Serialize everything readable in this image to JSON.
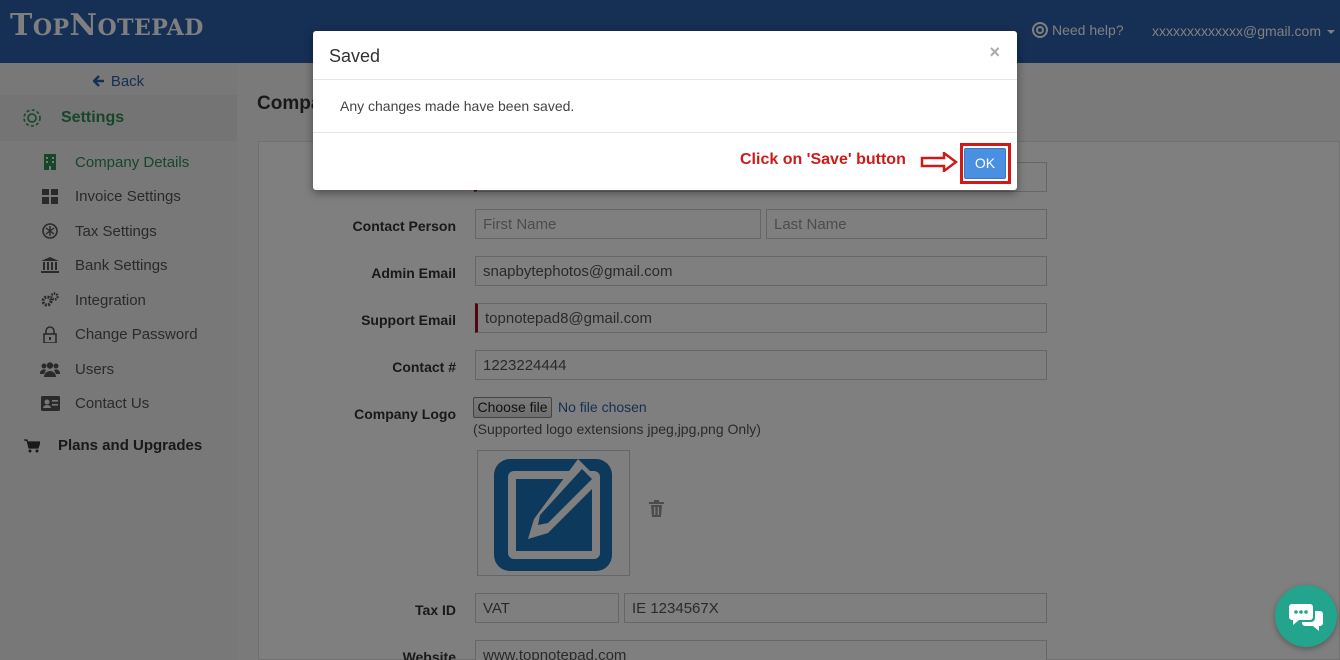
{
  "header": {
    "logo_big1": "T",
    "logo_small1": "OP",
    "logo_big2": "N",
    "logo_small2": "OTEPAD",
    "help_label": "Need help?",
    "account": "xxxxxxxxxxxxx@gmail.com"
  },
  "sidebar": {
    "back_label": "Back",
    "settings_label": "Settings",
    "items": [
      {
        "label": "Company Details",
        "icon": "building-icon",
        "active": true
      },
      {
        "label": "Invoice Settings",
        "icon": "grid-icon"
      },
      {
        "label": "Tax Settings",
        "icon": "tax-icon"
      },
      {
        "label": "Bank Settings",
        "icon": "bank-icon"
      },
      {
        "label": "Integration",
        "icon": "gears-icon"
      },
      {
        "label": "Change Password",
        "icon": "lock-icon"
      },
      {
        "label": "Users",
        "icon": "users-icon"
      },
      {
        "label": "Contact Us",
        "icon": "contact-card-icon"
      }
    ],
    "plans_label": "Plans and Upgrades"
  },
  "main": {
    "page_title": "Compa",
    "form": {
      "contact_person_label": "Contact Person",
      "first_name_placeholder": "First Name",
      "last_name_placeholder": "Last Name",
      "admin_email_label": "Admin Email",
      "admin_email_value": "snapbytephotos@gmail.com",
      "support_email_label": "Support Email",
      "support_email_value": "topnotepad8@gmail.com",
      "contact_label": "Contact #",
      "contact_value": "1223224444",
      "company_logo_label": "Company Logo",
      "choose_file_label": "Choose file",
      "no_file_label": "No file chosen",
      "logo_hint": "(Supported logo extensions jpeg,jpg,png Only)",
      "tax_id_label": "Tax ID",
      "tax_type_value": "VAT",
      "tax_id_value": "IE 1234567X",
      "website_label": "Website",
      "website_value": "www.topnotepad.com"
    }
  },
  "modal": {
    "title": "Saved",
    "close_glyph": "×",
    "message": "Any changes made have been saved.",
    "annotation": "Click on 'Save' button",
    "ok_label": "OK"
  },
  "colors": {
    "topbar": "#2c5fa8",
    "accent_green": "#2f8c55",
    "annotation_red": "#d01a1a",
    "ok_blue": "#4a90e2",
    "chat_teal": "#23a48d"
  }
}
